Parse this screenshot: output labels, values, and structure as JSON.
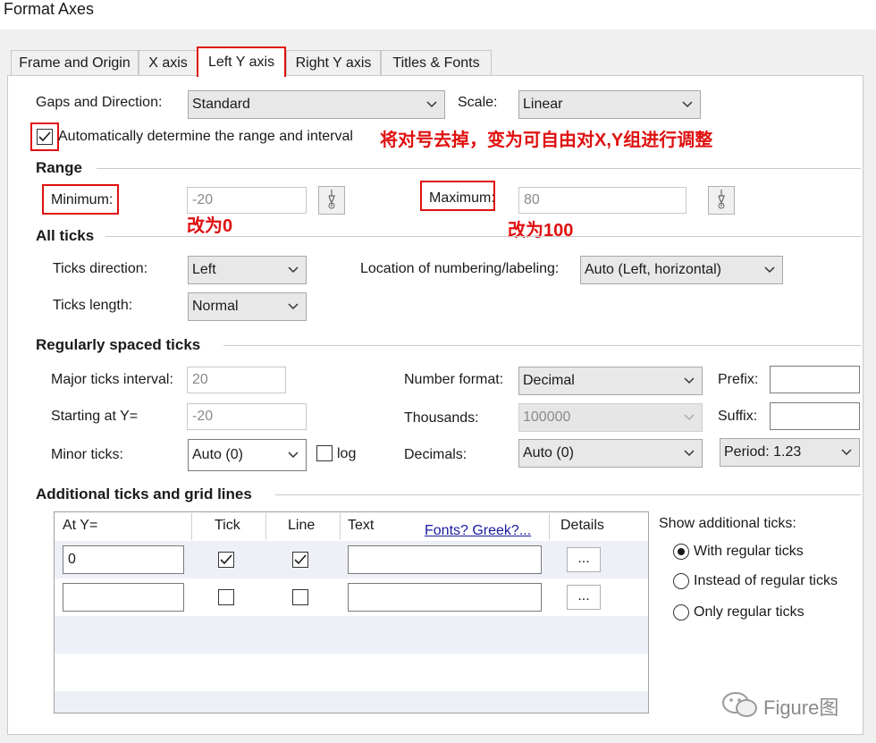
{
  "window": {
    "title": "Format Axes"
  },
  "tabs": [
    {
      "label": "Frame and Origin"
    },
    {
      "label": "X axis"
    },
    {
      "label": "Left Y axis"
    },
    {
      "label": "Right Y axis"
    },
    {
      "label": "Titles & Fonts"
    }
  ],
  "gaps": {
    "label": "Gaps and Direction:",
    "value": "Standard"
  },
  "scale": {
    "label": "Scale:",
    "value": "Linear"
  },
  "auto_range": {
    "label": "Automatically determine the range and interval",
    "checked": true
  },
  "annotations": {
    "auto_note": "将对号去掉，变为可自由对X,Y组进行调整",
    "min_note": "改为0",
    "max_note": "改为100"
  },
  "range": {
    "heading": "Range",
    "min_label": "Minimum:",
    "min_value": "-20",
    "max_label": "Maximum:",
    "max_value": "80"
  },
  "all_ticks": {
    "heading": "All ticks",
    "direction_label": "Ticks direction:",
    "direction_value": "Left",
    "length_label": "Ticks length:",
    "length_value": "Normal",
    "location_label": "Location of numbering/labeling:",
    "location_value": "Auto (Left, horizontal)"
  },
  "regular": {
    "heading": "Regularly spaced ticks",
    "major_label": "Major ticks interval:",
    "major_value": "20",
    "start_label": "Starting at Y=",
    "start_value": "-20",
    "minor_label": "Minor ticks:",
    "minor_value": "Auto (0)",
    "log_label": "log",
    "numfmt_label": "Number format:",
    "numfmt_value": "Decimal",
    "thousands_label": "Thousands:",
    "thousands_value": "100000",
    "decimals_label": "Decimals:",
    "decimals_value": "Auto (0)",
    "prefix_label": "Prefix:",
    "suffix_label": "Suffix:",
    "period_value": "Period: 1.23"
  },
  "additional": {
    "heading": "Additional ticks and grid lines",
    "columns": [
      "At Y=",
      "Tick",
      "Line",
      "Text",
      "Details"
    ],
    "fonts_link": "Fonts? Greek?...",
    "rows": [
      {
        "at": "0",
        "tick": true,
        "line": true,
        "text": "",
        "details": "..."
      },
      {
        "at": "",
        "tick": false,
        "line": false,
        "text": "",
        "details": "..."
      }
    ],
    "show_label": "Show additional ticks:",
    "options": [
      {
        "label": "With regular ticks",
        "selected": true
      },
      {
        "label": "Instead of regular ticks",
        "selected": false
      },
      {
        "label": "Only regular ticks",
        "selected": false
      }
    ]
  },
  "watermark": {
    "text": "Figure图"
  }
}
